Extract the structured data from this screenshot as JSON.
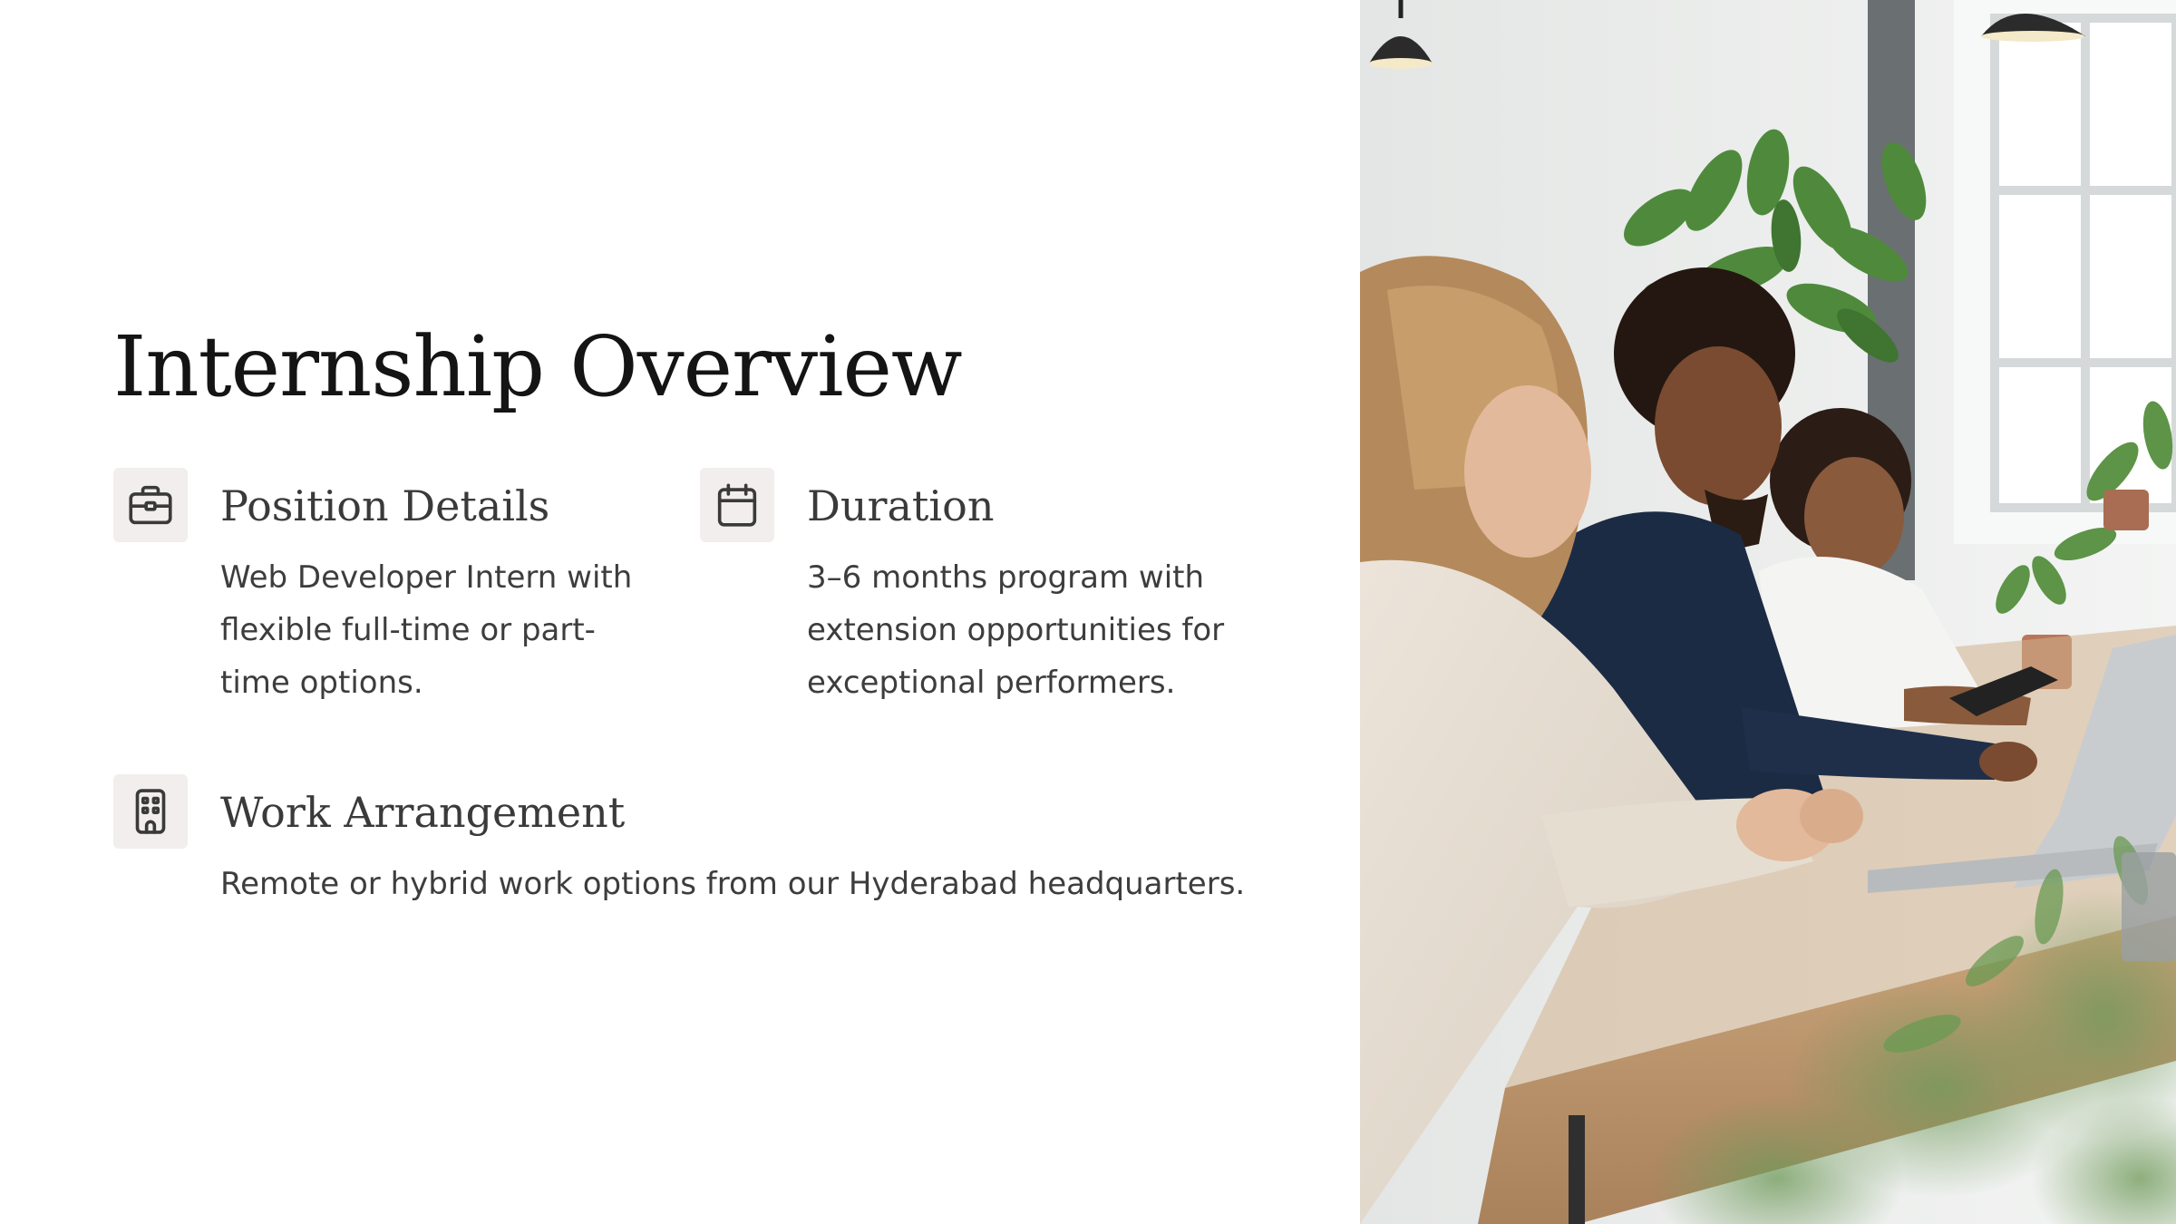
{
  "slide": {
    "title": "Internship Overview"
  },
  "features": {
    "position": {
      "icon": "briefcase-icon",
      "title": "Position Details",
      "description": "Web Developer Intern with flexible full-time or part-time options."
    },
    "duration": {
      "icon": "calendar-icon",
      "title": "Duration",
      "description": "3–6 months program with extension opportunities for exceptional performers."
    },
    "work": {
      "icon": "building-icon",
      "title": "Work Arrangement",
      "description": "Remote or hybrid work options from our Hyderabad headquarters."
    }
  },
  "colors": {
    "background": "#ffffff",
    "title_text": "#141414",
    "heading_text": "#3a3a3a",
    "body_text": "#3d3d3d",
    "icon_background": "#f1eeed",
    "icon_stroke": "#3a3a3a"
  },
  "photo": {
    "subject": "people-working-on-laptops-photo"
  }
}
